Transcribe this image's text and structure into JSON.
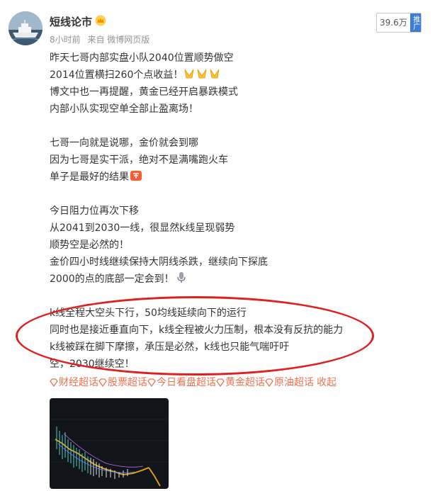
{
  "post": {
    "username": "短线论市",
    "time": "8小时前",
    "source": "来自 微博网页版",
    "counter": "39.6万",
    "promo_label": "推广",
    "lines": [
      "昨天七哥内部实盘小队2040位置顺势做空",
      "2014位置横扫260个点收益！",
      "博文中也一再提醒，黄金已经开启暴跌模式",
      "内部小队实现空单全部止盈离场！",
      "",
      "七哥一向就是说哪，金价就会到哪",
      "因为七哥是实干派，绝对不是满嘴跑火车",
      "单子是最好的结果",
      "",
      "今日阻力位再次下移",
      "从2041到2030一线，很显然k线呈现弱势",
      "顺势空是必然的！",
      "金价四小时线继续保持大阴线杀跌，继续向下探底",
      "2000的点的底部一定会到！",
      "",
      "k线全程大空头下行，50均线延续向下的运行",
      "同时也是接近垂直向下，k线全程被火力压制，根本没有反抗的能力",
      "k线被踩在脚下摩擦，承压是必然，k线也只能气喘吁吁",
      "空，2030继续空！"
    ],
    "topics": [
      "财经超话",
      "股票超话",
      "今日看盘超话",
      "黄金超话",
      "原油超话"
    ],
    "collapse": "收起"
  },
  "icons": {
    "vip": "crown-badge-icon",
    "emoji_line2": "praying-hands-emoji",
    "emoji_line8": "fighting-emoji",
    "emoji_line14": "microphone-emoji",
    "topic": "super-topic-diamond-icon"
  },
  "colors": {
    "accent": "#eb7350",
    "highlight": "#e02020",
    "meta": "#939393",
    "promo": "#3b7dd8"
  }
}
